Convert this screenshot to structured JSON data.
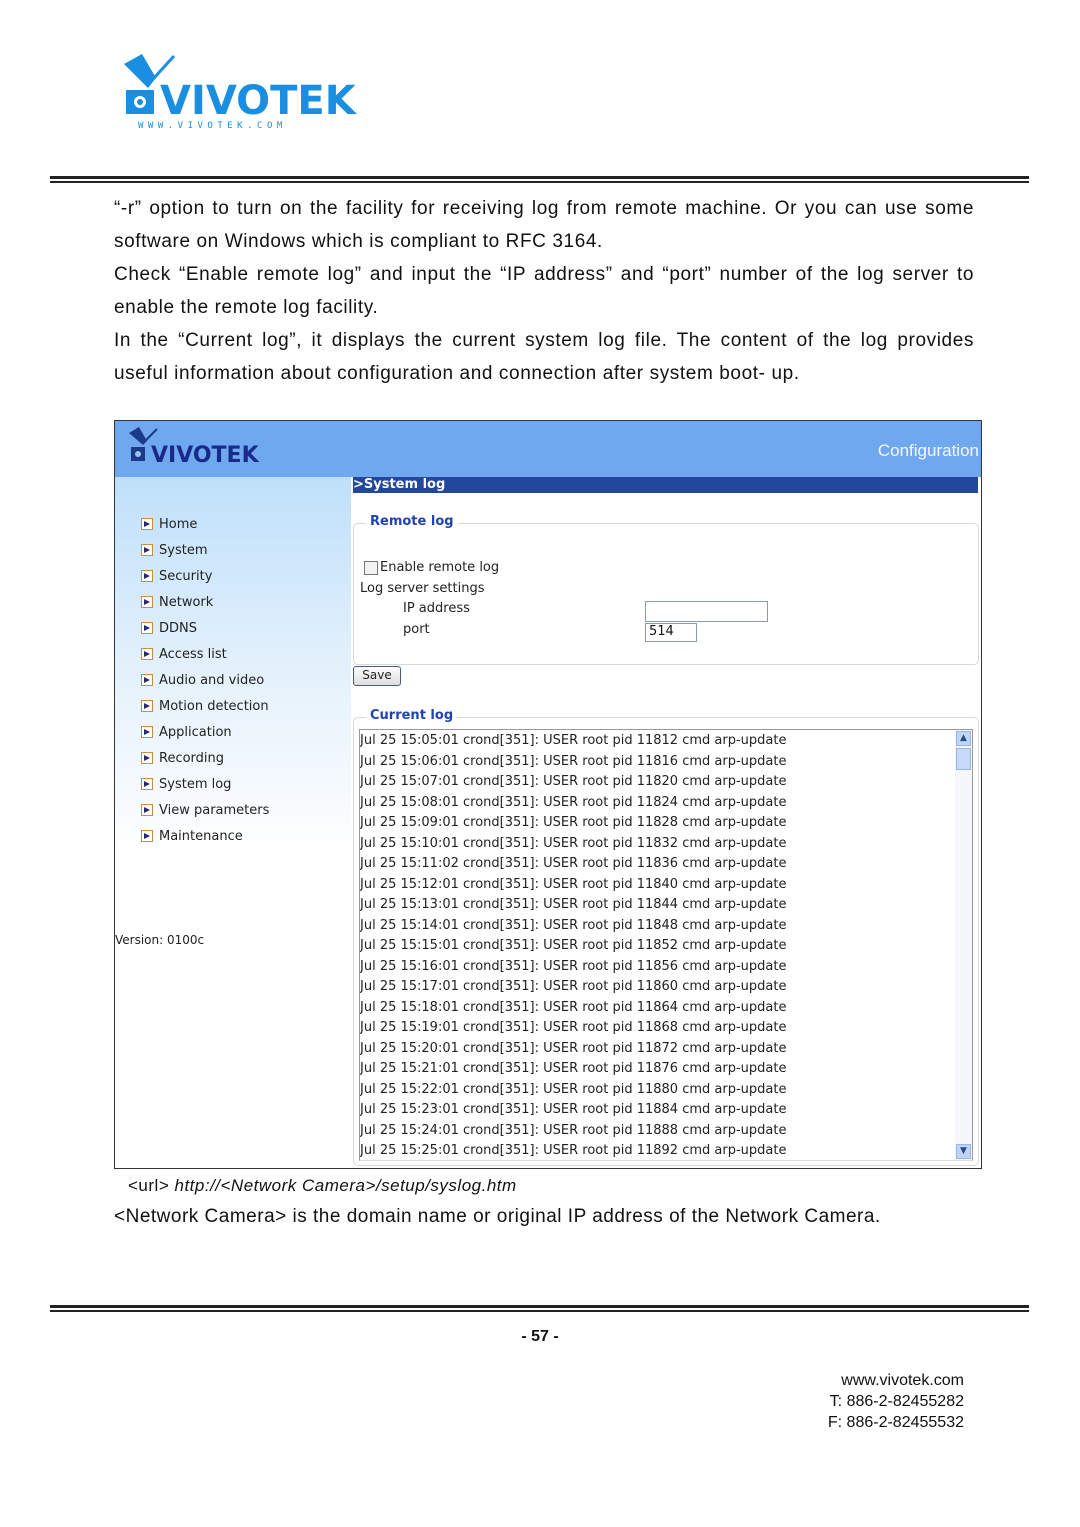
{
  "doc": {
    "logo_text": "VIVOTEK",
    "logo_url_text": "WWW.VIVOTEK.COM",
    "paragraphs": [
      "“-r” option to turn on the facility for receiving log from remote machine. Or you can use some software on Windows which is compliant to RFC 3164.",
      "Check “Enable remote log” and input the “IP address” and “port” number of the log server to enable the remote log facility.",
      "In the “Current log”, it displays the current system log file. The content of the log provides useful information about configuration and connection after system boot- up."
    ],
    "url_label": "<url>",
    "url_value": "http://<Network Camera>/setup/syslog.htm",
    "netcam_note": "<Network Camera> is the domain name or original IP address of the Network Camera.",
    "page_number": "- 57 -",
    "contact": {
      "website": "www.vivotek.com",
      "phone": "T: 886-2-82455282",
      "fax": "F: 886-2-82455532"
    }
  },
  "screenshot": {
    "logo_text": "VIVOTEK",
    "header_title": "Configuration",
    "section_title": ">System log",
    "sidebar": {
      "items": [
        {
          "label": "Home"
        },
        {
          "label": "System"
        },
        {
          "label": "Security"
        },
        {
          "label": "Network"
        },
        {
          "label": "DDNS"
        },
        {
          "label": "Access list"
        },
        {
          "label": "Audio and video"
        },
        {
          "label": "Motion detection"
        },
        {
          "label": "Application"
        },
        {
          "label": "Recording"
        },
        {
          "label": "System log"
        },
        {
          "label": "View parameters"
        },
        {
          "label": "Maintenance"
        }
      ],
      "version": "Version: 0100c"
    },
    "remote_log": {
      "legend": "Remote log",
      "enable_label": "Enable remote log",
      "enable_checked": false,
      "server_settings_label": "Log server settings",
      "ip_label": "IP address",
      "ip_value": "",
      "port_label": "port",
      "port_value": "514",
      "save_label": "Save"
    },
    "current_log": {
      "legend": "Current log",
      "lines": [
        "Jul 25 15:05:01 crond[351]: USER root pid 11812 cmd arp-update",
        "Jul 25 15:06:01 crond[351]: USER root pid 11816 cmd arp-update",
        "Jul 25 15:07:01 crond[351]: USER root pid 11820 cmd arp-update",
        "Jul 25 15:08:01 crond[351]: USER root pid 11824 cmd arp-update",
        "Jul 25 15:09:01 crond[351]: USER root pid 11828 cmd arp-update",
        "Jul 25 15:10:01 crond[351]: USER root pid 11832 cmd arp-update",
        "Jul 25 15:11:02 crond[351]: USER root pid 11836 cmd arp-update",
        "Jul 25 15:12:01 crond[351]: USER root pid 11840 cmd arp-update",
        "Jul 25 15:13:01 crond[351]: USER root pid 11844 cmd arp-update",
        "Jul 25 15:14:01 crond[351]: USER root pid 11848 cmd arp-update",
        "Jul 25 15:15:01 crond[351]: USER root pid 11852 cmd arp-update",
        "Jul 25 15:16:01 crond[351]: USER root pid 11856 cmd arp-update",
        "Jul 25 15:17:01 crond[351]: USER root pid 11860 cmd arp-update",
        "Jul 25 15:18:01 crond[351]: USER root pid 11864 cmd arp-update",
        "Jul 25 15:19:01 crond[351]: USER root pid 11868 cmd arp-update",
        "Jul 25 15:20:01 crond[351]: USER root pid 11872 cmd arp-update",
        "Jul 25 15:21:01 crond[351]: USER root pid 11876 cmd arp-update",
        "Jul 25 15:22:01 crond[351]: USER root pid 11880 cmd arp-update",
        "Jul 25 15:23:01 crond[351]: USER root pid 11884 cmd arp-update",
        "Jul 25 15:24:01 crond[351]: USER root pid 11888 cmd arp-update",
        "Jul 25 15:25:01 crond[351]: USER root pid 11892 cmd arp-update"
      ]
    }
  },
  "colors": {
    "brand_blue": "#1a8ee0",
    "header_blue": "#70a8ef",
    "section_bar": "#23479a",
    "legend_blue": "#1f44b2"
  }
}
